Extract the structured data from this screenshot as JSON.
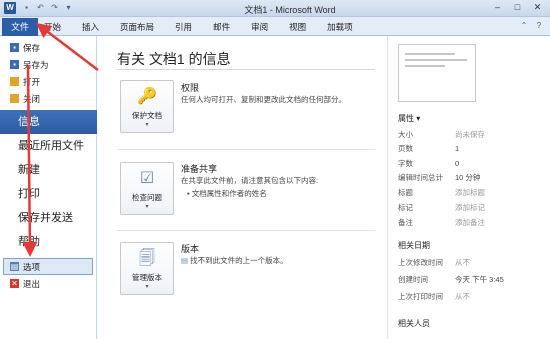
{
  "window": {
    "title": "文档1 - Microsoft Word",
    "app_icon_letter": "W",
    "qat_icons": [
      "save-icon",
      "undo-icon",
      "redo-icon",
      "customize-icon"
    ],
    "controls": [
      "minimize",
      "maximize",
      "close"
    ]
  },
  "ribbon": {
    "file_tab": "文件",
    "tabs": [
      "开始",
      "插入",
      "页面布局",
      "引用",
      "邮件",
      "审阅",
      "视图",
      "加载项"
    ]
  },
  "nav": {
    "small_items_top": [
      {
        "label": "保存",
        "icon": "save-icon",
        "color": "#3b6bb3"
      },
      {
        "label": "另存为",
        "icon": "save-as-icon",
        "color": "#3b6bb3"
      },
      {
        "label": "打开",
        "icon": "folder-open-icon",
        "color": "#e0a52a"
      },
      {
        "label": "关闭",
        "icon": "folder-close-icon",
        "color": "#e0a52a"
      }
    ],
    "big_items": [
      "信息",
      "最近所用文件",
      "新建",
      "打印",
      "保存并发送",
      "帮助"
    ],
    "active": "信息",
    "small_items_bottom": [
      {
        "label": "选项",
        "icon": "options-icon",
        "color": "#5c7fb0"
      },
      {
        "label": "退出",
        "icon": "exit-icon",
        "color": "#d0392b"
      }
    ]
  },
  "main": {
    "title": "有关 文档1 的信息",
    "blocks": [
      {
        "button_label": "保护文档",
        "icon": "lock-key-icon",
        "heading": "权限",
        "desc": "任何人均可打开、复制和更改此文档的任何部分。",
        "bullets": []
      },
      {
        "button_label": "检查问题",
        "icon": "checklist-icon",
        "heading": "准备共享",
        "desc": "在共享此文件前，请注意其包含以下内容:",
        "bullets": [
          "文档属性和作者的姓名"
        ]
      },
      {
        "button_label": "管理版本",
        "icon": "versions-icon",
        "heading": "版本",
        "desc": "找不到此文件的上一个版本。",
        "bullets": []
      }
    ]
  },
  "side": {
    "properties_label": "属性 ▾",
    "properties": [
      {
        "key": "大小",
        "value": "尚未保存",
        "muted": true
      },
      {
        "key": "页数",
        "value": "1",
        "muted": false
      },
      {
        "key": "字数",
        "value": "0",
        "muted": false
      },
      {
        "key": "编辑时间总计",
        "value": "10 分钟",
        "muted": false
      },
      {
        "key": "标题",
        "value": "添加标题",
        "muted": true
      },
      {
        "key": "标记",
        "value": "添加标记",
        "muted": true
      },
      {
        "key": "备注",
        "value": "添加备注",
        "muted": true
      }
    ],
    "dates_label": "相关日期",
    "dates": [
      {
        "key": "上次修改时间",
        "value": "从不",
        "muted": true
      },
      {
        "key": "创建时间",
        "value": "今天 下午 3:45",
        "muted": false
      },
      {
        "key": "上次打印时间",
        "value": "从不",
        "muted": true
      }
    ],
    "people_label": "相关人员"
  },
  "colors": {
    "file_tab": "#2b5ea8",
    "nav_active": "#2c5ba4",
    "annotation": "#e53935"
  }
}
